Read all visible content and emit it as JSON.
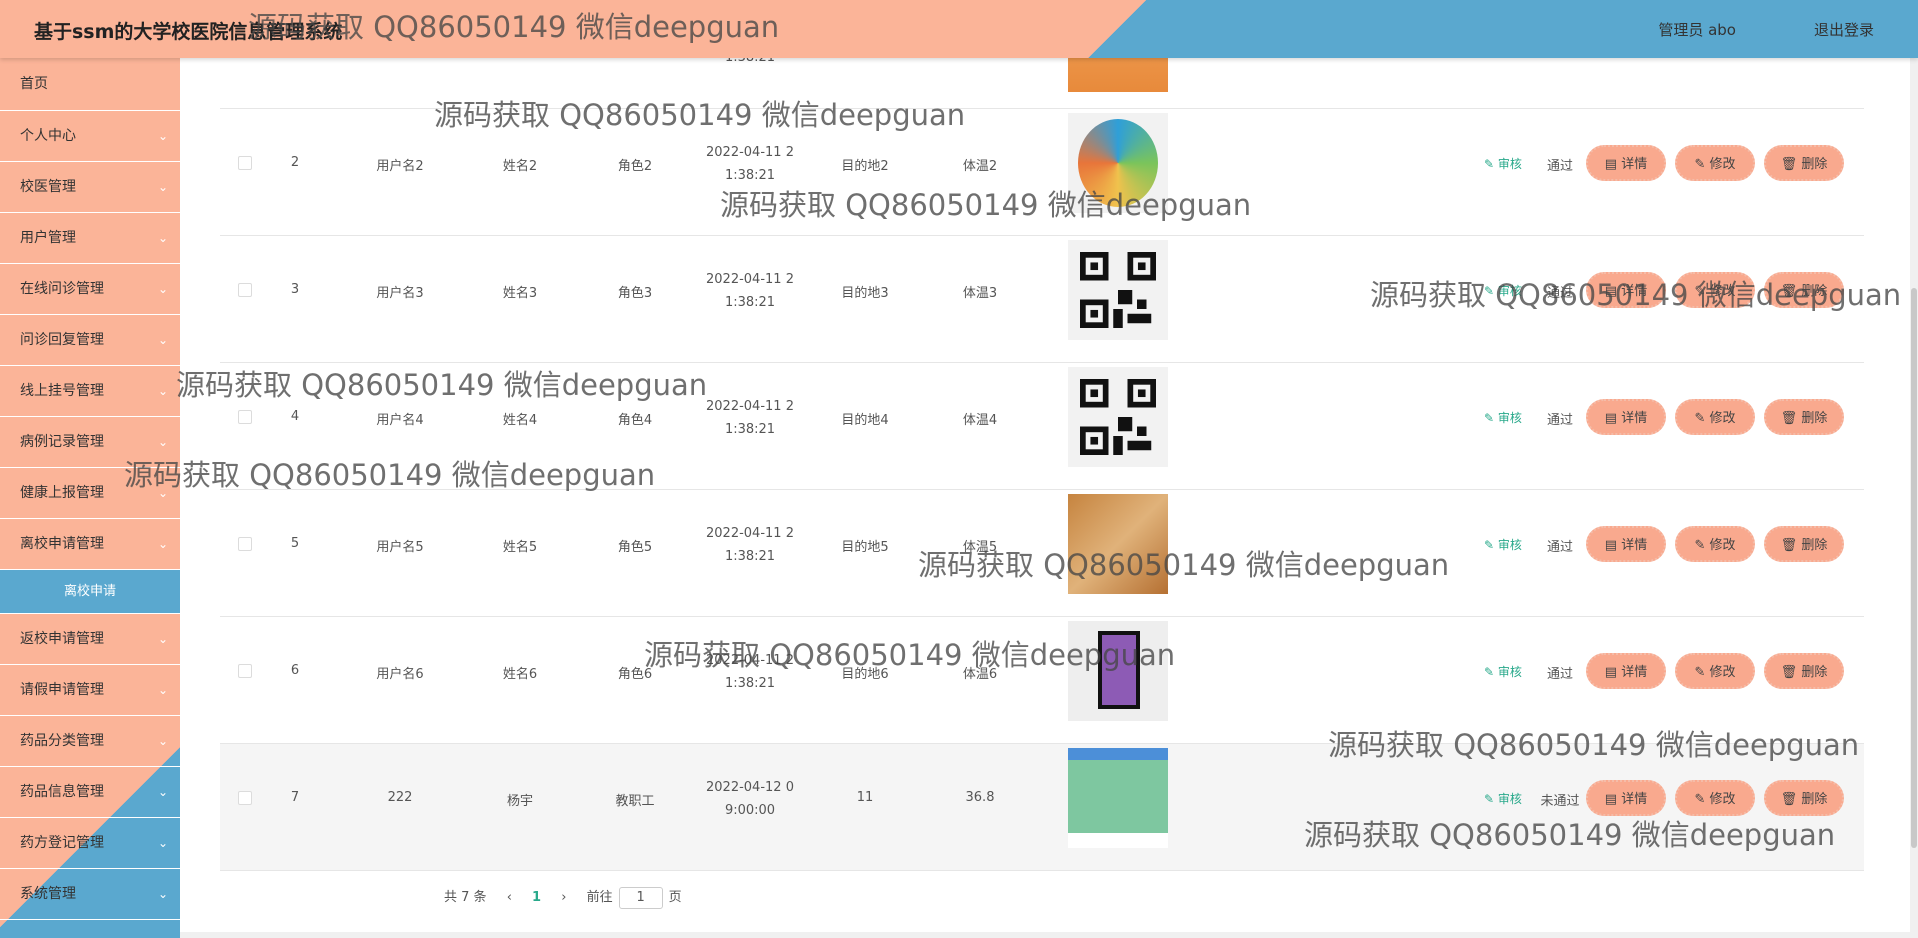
{
  "header": {
    "title": "基于ssm的大学校医院信息管理系统",
    "admin": "管理员 abo",
    "logout": "退出登录"
  },
  "sidebar": {
    "items": [
      {
        "label": "首页"
      },
      {
        "label": "个人中心"
      },
      {
        "label": "校医管理"
      },
      {
        "label": "用户管理"
      },
      {
        "label": "在线问诊管理"
      },
      {
        "label": "问诊回复管理"
      },
      {
        "label": "线上挂号管理"
      },
      {
        "label": "病例记录管理"
      },
      {
        "label": "健康上报管理"
      },
      {
        "label": "离校申请管理"
      }
    ],
    "active_sub": "离校申请",
    "items_after": [
      {
        "label": "返校申请管理"
      },
      {
        "label": "请假申请管理"
      },
      {
        "label": "药品分类管理"
      },
      {
        "label": "药品信息管理"
      },
      {
        "label": "药方登记管理"
      },
      {
        "label": "系统管理"
      }
    ]
  },
  "table": {
    "partial_top_time": "1:38:21",
    "rows": [
      {
        "index": "2",
        "username": "用户名2",
        "name": "姓名2",
        "role": "角色2",
        "time1": "2022-04-11 2",
        "time2": "1:38:21",
        "destination": "目的地2",
        "temperature": "体温2",
        "status": "通过",
        "image": "colorful-qr"
      },
      {
        "index": "3",
        "username": "用户名3",
        "name": "姓名3",
        "role": "角色3",
        "time1": "2022-04-11 2",
        "time2": "1:38:21",
        "destination": "目的地3",
        "temperature": "体温3",
        "status": "通过",
        "image": "qr-code"
      },
      {
        "index": "4",
        "username": "用户名4",
        "name": "姓名4",
        "role": "角色4",
        "time1": "2022-04-11 2",
        "time2": "1:38:21",
        "destination": "目的地4",
        "temperature": "体温4",
        "status": "通过",
        "image": "qr-code"
      },
      {
        "index": "5",
        "username": "用户名5",
        "name": "姓名5",
        "role": "角色5",
        "time1": "2022-04-11 2",
        "time2": "1:38:21",
        "destination": "目的地5",
        "temperature": "体温5",
        "status": "通过",
        "image": "wood-qr"
      },
      {
        "index": "6",
        "username": "用户名6",
        "name": "姓名6",
        "role": "角色6",
        "time1": "2022-04-11 2",
        "time2": "1:38:21",
        "destination": "目的地6",
        "temperature": "体温6",
        "status": "通过",
        "image": "framed-qr"
      },
      {
        "index": "7",
        "username": "222",
        "name": "杨宇",
        "role": "教职工",
        "time1": "2022-04-12 0",
        "time2": "9:00:00",
        "destination": "11",
        "temperature": "36.8",
        "status": "未通过",
        "image": "green-screenshot"
      }
    ],
    "audit_label": "审核",
    "detail_label": "详情",
    "edit_label": "修改",
    "delete_label": "删除"
  },
  "pagination": {
    "total": "共 7 条",
    "prev": "‹",
    "current": "1",
    "next": "›",
    "goto": "前往",
    "page_input": "1",
    "page_suffix": "页"
  },
  "watermark": "源码获取 QQ86050149 微信deepguan",
  "colors": {
    "salmon": "#fbb498",
    "blue": "#5aa8cf",
    "button": "#f9a98e",
    "audit": "#29a98b"
  },
  "icons": [
    "chevron-down-icon",
    "edit-icon",
    "document-icon",
    "trash-icon"
  ]
}
